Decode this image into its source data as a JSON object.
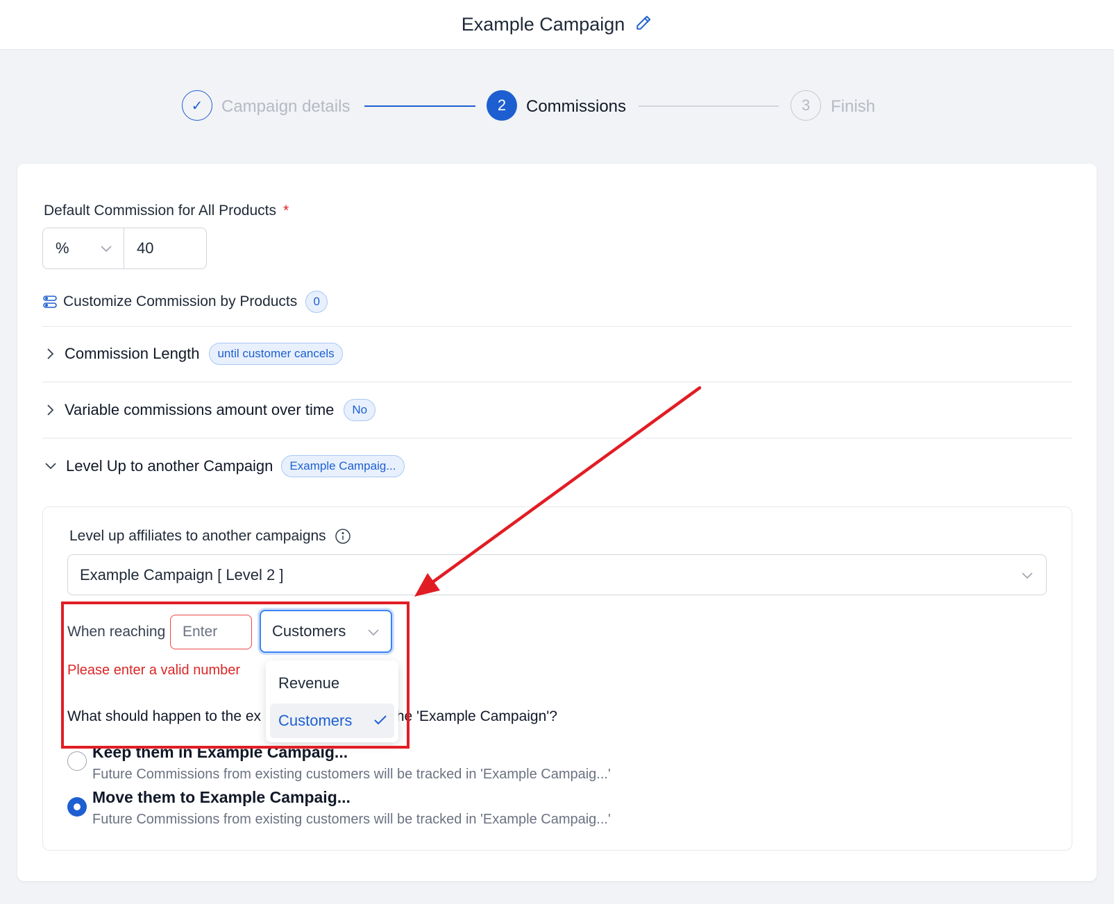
{
  "header": {
    "title": "Example Campaign"
  },
  "stepper": {
    "steps": [
      {
        "number": "✓",
        "label": "Campaign details",
        "state": "done"
      },
      {
        "number": "2",
        "label": "Commissions",
        "state": "active"
      },
      {
        "number": "3",
        "label": "Finish",
        "state": "upcoming"
      }
    ]
  },
  "default_commission": {
    "label": "Default Commission for All Products",
    "required_mark": "*",
    "unit": "%",
    "value": "40"
  },
  "customize": {
    "label": "Customize Commission by Products",
    "count": "0"
  },
  "sections": {
    "commission_length": {
      "title": "Commission Length",
      "badge": "until customer cancels"
    },
    "variable": {
      "title": "Variable commissions amount over time",
      "badge": "No"
    },
    "level_up": {
      "title": "Level Up to another Campaign",
      "badge": "Example Campaig..."
    }
  },
  "level_up": {
    "label": "Level up affiliates to another campaigns",
    "selected_campaign": "Example Campaign [ Level 2 ]",
    "when_reaching": "When reaching",
    "threshold_placeholder": "Enter",
    "metric": "Customers",
    "error": "Please enter a valid number",
    "question_start": "What should happen to the ex",
    "question_end": "the 'Example Campaign'?",
    "dropdown_options": [
      {
        "label": "Revenue",
        "selected": false
      },
      {
        "label": "Customers",
        "selected": true
      }
    ],
    "options": [
      {
        "title": "Keep them in Example Campaig...",
        "desc": "Future Commissions from existing customers will be tracked in 'Example Campaig...'",
        "checked": false
      },
      {
        "title": "Move them to Example Campaig...",
        "desc": "Future Commissions from existing customers will be tracked in 'Example Campaig...'",
        "checked": true
      }
    ]
  },
  "colors": {
    "primary": "#1d5fd1",
    "error": "#dc2626",
    "annotation": "#e11d24"
  }
}
